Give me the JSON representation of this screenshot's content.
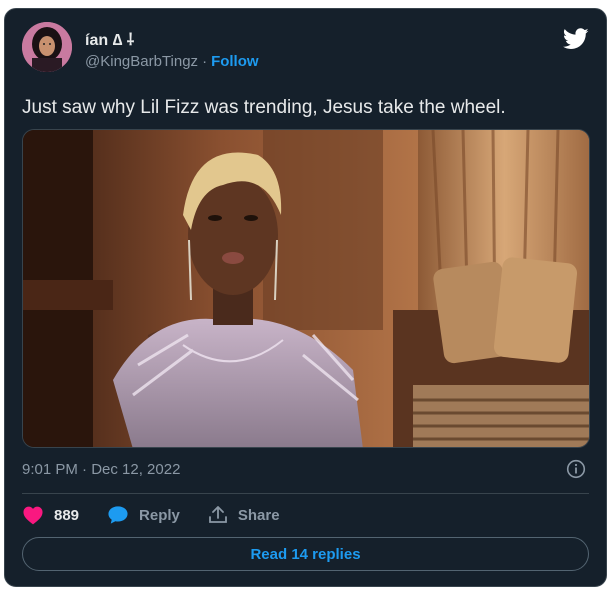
{
  "author": {
    "display_name": "ían ∆ ⸸",
    "handle": "@KingBarbTingz",
    "separator": "·",
    "follow_label": "Follow"
  },
  "tweet": {
    "text": "Just saw why Lil Fizz was trending, Jesus take the wheel.",
    "timestamp": "9:01 PM · Dec 12, 2022"
  },
  "actions": {
    "like_count": "889",
    "reply_label": "Reply",
    "share_label": "Share"
  },
  "read_replies_label": "Read 14 replies",
  "colors": {
    "background": "#15202b",
    "accent": "#1d9bf0",
    "like": "#f91880"
  },
  "icons": [
    "twitter-bird-icon",
    "info-icon",
    "heart-icon",
    "reply-bubble-icon",
    "share-icon"
  ]
}
